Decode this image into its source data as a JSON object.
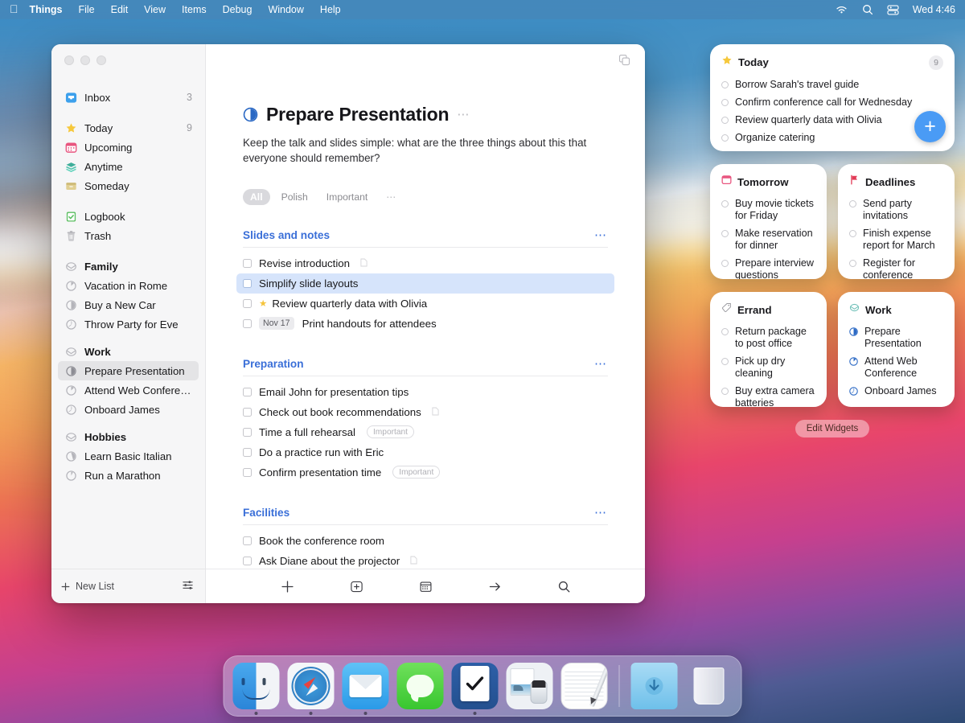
{
  "menubar": {
    "apple_icon": "apple-logo",
    "items": [
      {
        "label": "Things",
        "bold": true
      },
      {
        "label": "File",
        "bold": false
      },
      {
        "label": "Edit",
        "bold": false
      },
      {
        "label": "View",
        "bold": false
      },
      {
        "label": "Items",
        "bold": false
      },
      {
        "label": "Debug",
        "bold": false
      },
      {
        "label": "Window",
        "bold": false
      },
      {
        "label": "Help",
        "bold": false
      }
    ],
    "status_icons": [
      "wifi-icon",
      "search-icon",
      "control-center-icon"
    ],
    "clock": "Wed 4:46"
  },
  "window": {
    "sidebar": {
      "groups": [
        {
          "items": [
            {
              "label": "Inbox",
              "count": "3",
              "icon": "inbox-icon"
            }
          ]
        },
        {
          "items": [
            {
              "label": "Today",
              "count": "9",
              "icon": "star-icon"
            },
            {
              "label": "Upcoming",
              "count": "",
              "icon": "calendar-icon"
            },
            {
              "label": "Anytime",
              "count": "",
              "icon": "layers-icon"
            },
            {
              "label": "Someday",
              "count": "",
              "icon": "box-icon"
            }
          ]
        },
        {
          "items": [
            {
              "label": "Logbook",
              "count": "",
              "icon": "logbook-icon"
            },
            {
              "label": "Trash",
              "count": "",
              "icon": "trash-icon"
            }
          ]
        },
        {
          "items": [
            {
              "label": "Family",
              "count": "",
              "icon": "area-icon",
              "header": true
            },
            {
              "label": "Vacation in Rome",
              "count": "",
              "icon": "project-pie-icon"
            },
            {
              "label": "Buy a New Car",
              "count": "",
              "icon": "project-pie-icon"
            },
            {
              "label": "Throw Party for Eve",
              "count": "",
              "icon": "project-pie-icon"
            }
          ]
        },
        {
          "items": [
            {
              "label": "Work",
              "count": "",
              "icon": "area-icon",
              "header": true
            },
            {
              "label": "Prepare Presentation",
              "count": "",
              "icon": "project-pie-icon",
              "selected": true
            },
            {
              "label": "Attend Web Conference",
              "count": "",
              "icon": "project-pie-icon"
            },
            {
              "label": "Onboard James",
              "count": "",
              "icon": "project-pie-icon"
            }
          ]
        },
        {
          "items": [
            {
              "label": "Hobbies",
              "count": "",
              "icon": "area-icon",
              "header": true
            },
            {
              "label": "Learn Basic Italian",
              "count": "",
              "icon": "project-pie-icon"
            },
            {
              "label": "Run a Marathon",
              "count": "",
              "icon": "project-pie-icon"
            }
          ]
        }
      ],
      "footer": {
        "new_list_label": "New List",
        "filter_icon": "sliders-icon",
        "plus_icon": "plus-icon"
      }
    },
    "main": {
      "copy_icon": "duplicate-icon",
      "project_title": "Prepare Presentation",
      "project_menu_icon": "ellipsis-icon",
      "note": "Keep the talk and slides simple: what are the three things about this that everyone should remember?",
      "tags": [
        {
          "label": "All",
          "active": true
        },
        {
          "label": "Polish",
          "active": false
        },
        {
          "label": "Important",
          "active": false
        },
        {
          "label": "…",
          "active": false,
          "more": true
        }
      ],
      "sections": [
        {
          "title": "Slides and notes",
          "tasks": [
            {
              "label": "Revise introduction",
              "has_note": true,
              "starred": false,
              "selected": false,
              "date": "",
              "tag": ""
            },
            {
              "label": "Simplify slide layouts",
              "has_note": false,
              "starred": false,
              "selected": true,
              "date": "",
              "tag": ""
            },
            {
              "label": "Review quarterly data with Olivia",
              "has_note": false,
              "starred": true,
              "selected": false,
              "date": "",
              "tag": ""
            },
            {
              "label": "Print handouts for attendees",
              "has_note": false,
              "starred": false,
              "selected": false,
              "date": "Nov 17",
              "tag": ""
            }
          ]
        },
        {
          "title": "Preparation",
          "tasks": [
            {
              "label": "Email John for presentation tips",
              "has_note": false,
              "starred": false,
              "selected": false,
              "date": "",
              "tag": ""
            },
            {
              "label": "Check out book recommendations",
              "has_note": true,
              "starred": false,
              "selected": false,
              "date": "",
              "tag": ""
            },
            {
              "label": "Time a full rehearsal",
              "has_note": false,
              "starred": false,
              "selected": false,
              "date": "",
              "tag": "Important"
            },
            {
              "label": "Do a practice run with Eric",
              "has_note": false,
              "starred": false,
              "selected": false,
              "date": "",
              "tag": ""
            },
            {
              "label": "Confirm presentation time",
              "has_note": false,
              "starred": false,
              "selected": false,
              "date": "",
              "tag": "Important"
            }
          ]
        },
        {
          "title": "Facilities",
          "tasks": [
            {
              "label": "Book the conference room",
              "has_note": false,
              "starred": false,
              "selected": false,
              "date": "",
              "tag": ""
            },
            {
              "label": "Ask Diane about the projector",
              "has_note": true,
              "starred": false,
              "selected": false,
              "date": "",
              "tag": ""
            }
          ]
        }
      ],
      "toolbar": [
        "new-todo-icon",
        "new-heading-icon",
        "when-calendar-icon",
        "move-arrow-icon",
        "search-icon"
      ]
    }
  },
  "widgets": {
    "today": {
      "title": "Today",
      "icon": "star-icon",
      "count": "9",
      "items": [
        "Borrow Sarah's travel guide",
        "Confirm conference call for Wednesday",
        "Review quarterly data with Olivia",
        "Organize catering"
      ],
      "fab_label": "+"
    },
    "tomorrow": {
      "title": "Tomorrow",
      "icon": "calendar-icon",
      "items": [
        "Buy movie tickets for Friday",
        "Make reservation for dinner",
        "Prepare interview questions"
      ]
    },
    "deadlines": {
      "title": "Deadlines",
      "icon": "flag-icon",
      "items": [
        "Send party invitations",
        "Finish expense report for March",
        "Register for conference"
      ]
    },
    "errand": {
      "title": "Errand",
      "icon": "tag-icon",
      "items": [
        "Return package to post office",
        "Pick up dry cleaning",
        "Buy extra camera batteries"
      ]
    },
    "work": {
      "title": "Work",
      "icon": "area-icon",
      "items": [
        "Prepare Presentation",
        "Attend Web Conference",
        "Onboard James"
      ]
    },
    "edit_button": "Edit Widgets"
  },
  "dock": {
    "items": [
      {
        "name": "finder",
        "running": true
      },
      {
        "name": "safari",
        "running": true
      },
      {
        "name": "mail",
        "running": true
      },
      {
        "name": "messages",
        "running": false
      },
      {
        "name": "things",
        "running": true
      },
      {
        "name": "photos",
        "running": false
      },
      {
        "name": "notes",
        "running": false
      },
      {
        "name": "downloads-folder",
        "running": false
      },
      {
        "name": "trash",
        "running": false
      }
    ]
  },
  "colors": {
    "accent_blue": "#3a6fd8",
    "selection_blue": "#d6e4fb",
    "star_yellow": "#f5c43c",
    "fab_blue": "#4a9bf5",
    "project_blue": "#2a68c4"
  }
}
